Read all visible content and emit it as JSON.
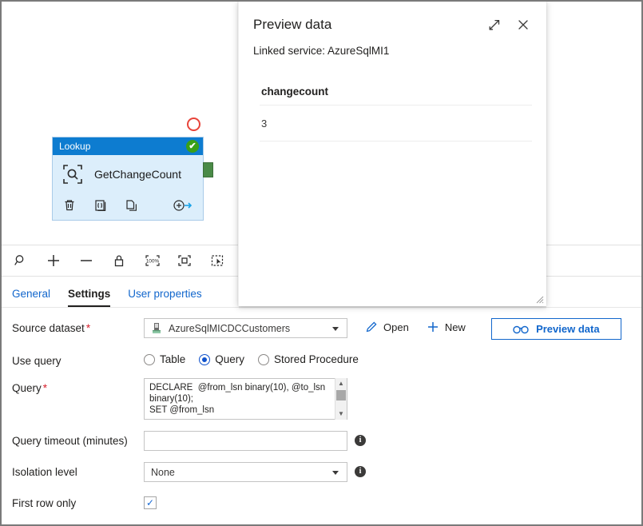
{
  "canvas": {
    "activity": {
      "type_label": "Lookup",
      "name": "GetChangeCount",
      "status_glyph": "✔",
      "icon_name": "lookup-magnifier-icon",
      "actions": [
        {
          "name": "delete-activity-icon",
          "label": "Delete"
        },
        {
          "name": "code-view-icon",
          "label": "Code"
        },
        {
          "name": "duplicate-activity-icon",
          "label": "Clone"
        },
        {
          "name": "add-output-connector-icon",
          "label": "Add output"
        }
      ]
    }
  },
  "toolbar": {
    "buttons": [
      {
        "name": "zoom-search-icon",
        "label": "Zoom"
      },
      {
        "name": "zoom-in-icon",
        "label": "Zoom in"
      },
      {
        "name": "zoom-out-icon",
        "label": "Zoom out"
      },
      {
        "name": "lock-canvas-icon",
        "label": "Lock"
      },
      {
        "name": "zoom-100-percent-icon",
        "label": "100%"
      },
      {
        "name": "zoom-to-fit-icon",
        "label": "Zoom to fit"
      },
      {
        "name": "auto-align-icon",
        "label": "Auto align"
      }
    ],
    "zoom_level_label": "100%"
  },
  "tabs": [
    {
      "label": "General",
      "active": false
    },
    {
      "label": "Settings",
      "active": true
    },
    {
      "label": "User properties",
      "active": false
    }
  ],
  "form": {
    "source_dataset": {
      "label": "Source dataset",
      "required": "*",
      "value": "AzureSqlMICDCCustomers",
      "open_label": "Open",
      "new_label": "New",
      "preview_label": "Preview data",
      "preview_icon_glyph": "6ᴏ"
    },
    "use_query": {
      "label": "Use query",
      "options": [
        {
          "label": "Table",
          "selected": false
        },
        {
          "label": "Query",
          "selected": true
        },
        {
          "label": "Stored Procedure",
          "selected": false
        }
      ]
    },
    "query": {
      "label": "Query",
      "required": "*",
      "value": "DECLARE  @from_lsn binary(10), @to_lsn binary(10);\nSET @from_lsn"
    },
    "query_timeout": {
      "label": "Query timeout (minutes)",
      "value": "",
      "placeholder": ""
    },
    "isolation_level": {
      "label": "Isolation level",
      "value": "None"
    },
    "first_row_only": {
      "label": "First row only",
      "checked_glyph": "✓"
    },
    "info_glyph": "i"
  },
  "preview_panel": {
    "title": "Preview data",
    "linked_service": "Linked service: AzureSqlMI1",
    "expand_icon": "expand-diagonal-icon",
    "close_icon": "close-icon",
    "table": {
      "columns": [
        "changecount"
      ],
      "rows": [
        [
          "3"
        ]
      ]
    }
  },
  "colors": {
    "accent_blue": "#1166cc",
    "node_header_blue": "#0d7cd0",
    "node_body_blue": "#dceefb",
    "status_green": "#3aa017",
    "connector_green": "#4a8a47",
    "required_red": "#d6202c",
    "marker_red": "#e8443a"
  }
}
